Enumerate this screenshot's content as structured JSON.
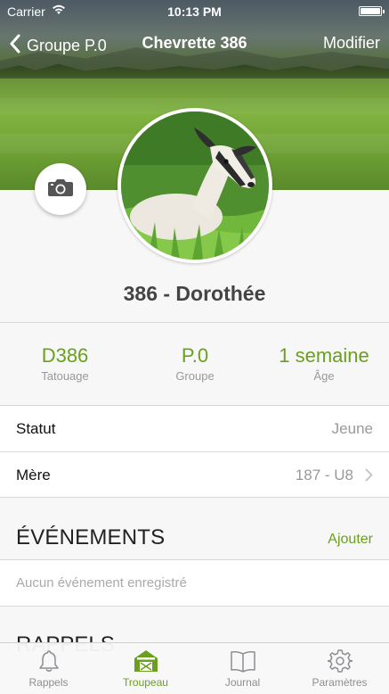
{
  "status_bar": {
    "carrier": "Carrier",
    "time": "10:13 PM",
    "wifi_icon": "wifi-icon",
    "battery_icon": "battery-icon"
  },
  "nav": {
    "back_label": "Groupe P.0",
    "title": "Chevrette 386",
    "edit_label": "Modifier"
  },
  "profile": {
    "name": "386 - Dorothée",
    "camera_icon": "camera-icon"
  },
  "stats": [
    {
      "value": "D386",
      "label": "Tatouage"
    },
    {
      "value": "P.0",
      "label": "Groupe"
    },
    {
      "value": "1 semaine",
      "label": "Âge"
    }
  ],
  "details": {
    "status": {
      "label": "Statut",
      "value": "Jeune"
    },
    "mother": {
      "label": "Mère",
      "value": "187 - U8"
    }
  },
  "events": {
    "title": "ÉVÉNEMENTS",
    "add_label": "Ajouter",
    "empty_text": "Aucun événement enregistré"
  },
  "reminders": {
    "title": "RAPPELS"
  },
  "tabs": [
    {
      "label": "Rappels",
      "icon": "bell-icon"
    },
    {
      "label": "Troupeau",
      "icon": "barn-icon",
      "active": true
    },
    {
      "label": "Journal",
      "icon": "book-icon"
    },
    {
      "label": "Paramètres",
      "icon": "gear-icon"
    }
  ],
  "colors": {
    "accent": "#6a9f1f",
    "muted": "#999999",
    "background": "#f7f7f7"
  }
}
